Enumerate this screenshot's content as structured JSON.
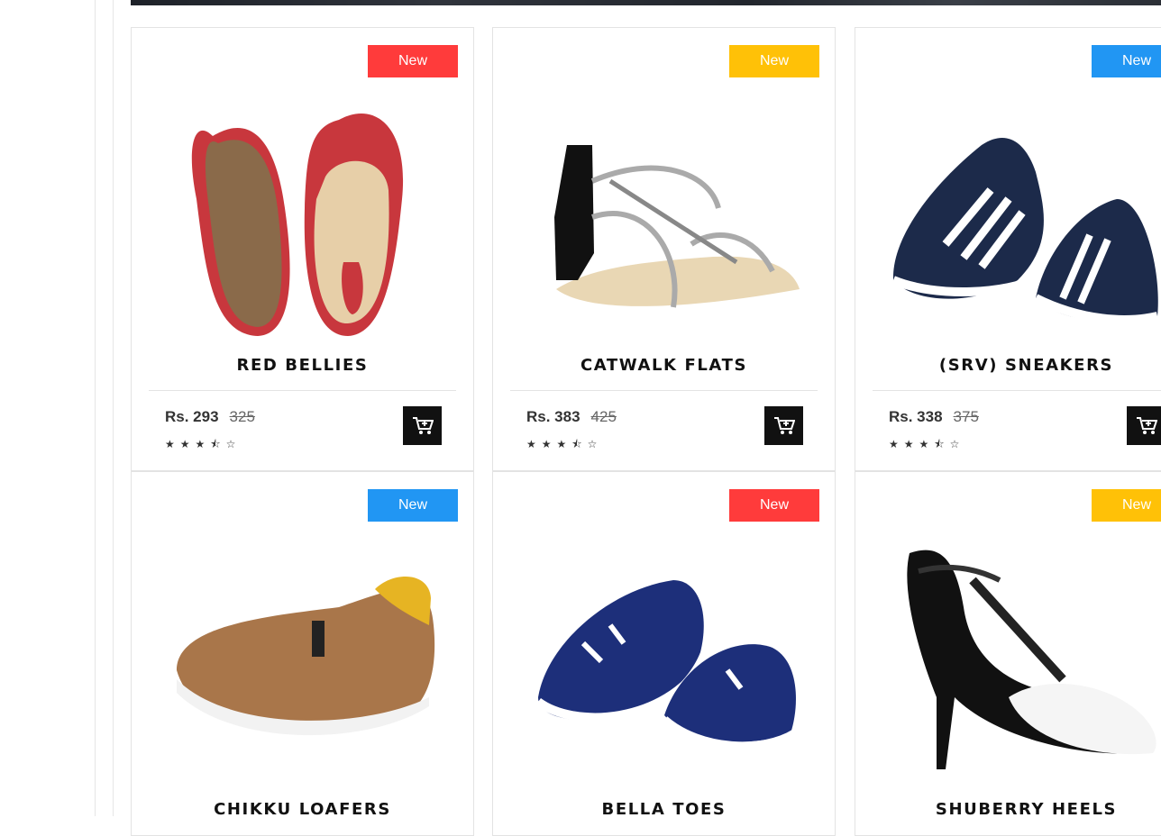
{
  "products": [
    {
      "title": "RED BELLIES",
      "badge": "New",
      "badge_color": "#ff3b3b",
      "price": "Rs. 293",
      "old_price": "325",
      "stars": "★★★⯪☆",
      "rating": 3.5
    },
    {
      "title": "CATWALK FLATS",
      "badge": "New",
      "badge_color": "#ffc107",
      "price": "Rs. 383",
      "old_price": "425",
      "stars": "★★★⯪☆",
      "rating": 3.5
    },
    {
      "title": "(SRV) SNEAKERS",
      "badge": "New",
      "badge_color": "#2196f3",
      "price": "Rs. 338",
      "old_price": "375",
      "stars": "★★★⯪☆",
      "rating": 3.5
    },
    {
      "title": "CHIKKU LOAFERS",
      "badge": "New",
      "badge_color": "#2196f3"
    },
    {
      "title": "BELLA TOES",
      "badge": "New",
      "badge_color": "#ff3b3b"
    },
    {
      "title": "SHUBERRY HEELS",
      "badge": "New",
      "badge_color": "#ffc107"
    }
  ],
  "icons": {
    "cart": "add-to-cart-icon"
  }
}
